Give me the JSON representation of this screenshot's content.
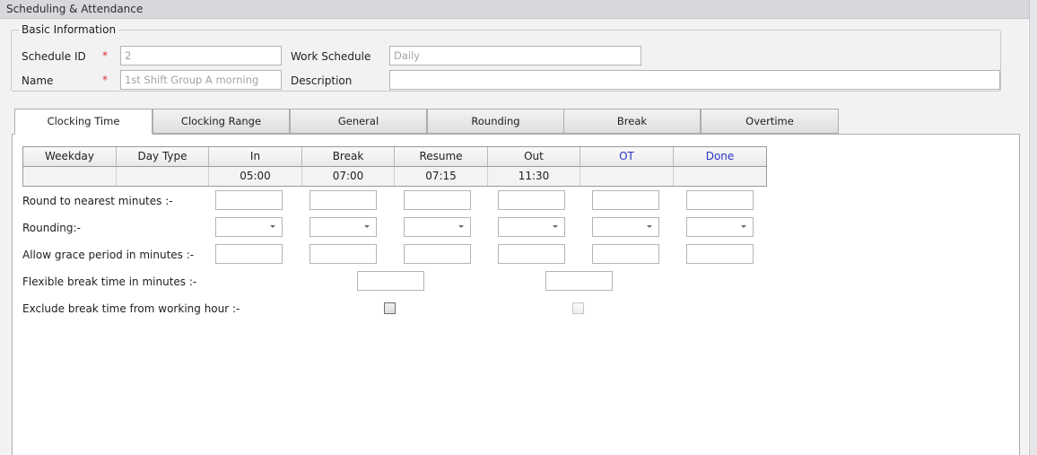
{
  "window": {
    "title": "Scheduling & Attendance"
  },
  "basic_info": {
    "legend": "Basic Information",
    "schedule_id": {
      "label": "Schedule ID",
      "required_mark": "*",
      "value": "2"
    },
    "name": {
      "label": "Name",
      "required_mark": "*",
      "value": "1st Shift Group A morning"
    },
    "work_schedule": {
      "label": "Work Schedule",
      "value": "Daily"
    },
    "description": {
      "label": "Description",
      "value": ""
    }
  },
  "tabs": [
    "Clocking Time",
    "Clocking Range",
    "General",
    "Rounding",
    "Break",
    "Overtime"
  ],
  "active_tab": "Clocking Time",
  "grid": {
    "headers": [
      "Weekday",
      "Day Type",
      "In",
      "Break",
      "Resume",
      "Out",
      "OT",
      "Done"
    ],
    "rows": [
      [
        "",
        "",
        "05:00",
        "07:00",
        "07:15",
        "11:30",
        "",
        ""
      ]
    ]
  },
  "settings": {
    "round_label": "Round to nearest minutes :-",
    "rounding_label": "Rounding:-",
    "grace_label": "Allow grace period in minutes :-",
    "flex_break_label": "Flexible break time in minutes :-",
    "exclude_break_label": "Exclude break time from working hour :-"
  },
  "colors": {
    "required": "#d9302c",
    "blue_header": "#2a35c9",
    "panel_bg": "#f2f2f2"
  }
}
